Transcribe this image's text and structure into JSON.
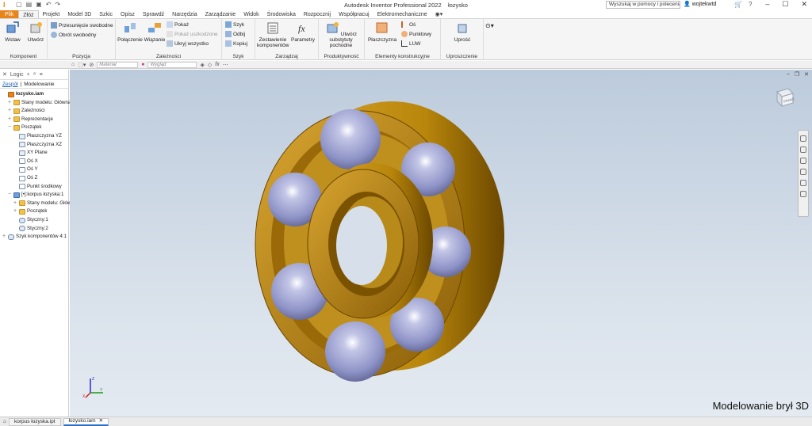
{
  "app": {
    "logo": "I",
    "title": "Autodesk Inventor Professional 2022",
    "document": "łozysko",
    "help_search_placeholder": "Wyszukaj w pomocy i poleceniach...",
    "user": "wojtekwtd",
    "win_buttons": [
      "–",
      "☐",
      "✕"
    ]
  },
  "ribbon_tabs": [
    "Plik",
    "Złóż",
    "Projekt",
    "Model 3D",
    "Szkic",
    "Opisz",
    "Sprawdź",
    "Narzędzia",
    "Zarządzanie",
    "Widok",
    "Środowiska",
    "Rozpocznij",
    "Współpracuj",
    "Elektromechaniczne"
  ],
  "ribbon": {
    "komponent": {
      "title": "Komponent",
      "wstaw": "Wstaw",
      "utworz": "Utwórz"
    },
    "pozycja": {
      "title": "Pozycja",
      "przesuniecie": "Przesunięcie swobodne",
      "obrot": "Obrót swobodny"
    },
    "zaleznosci": {
      "title": "Zależności",
      "polaczenie": "Połączenie",
      "wiazanie": "Wiązanie",
      "pokaz": "Pokaż",
      "pokaz_uszkodzone": "Pokaż uszkodzone",
      "ukryj": "Ukryj wszystko"
    },
    "szyk": {
      "title": "Szyk",
      "szyk": "Szyk",
      "odbij": "Odbij",
      "kopiuj": "Kopiuj"
    },
    "zarzadzaj": {
      "title": "Zarządzaj",
      "zestawienie": "Zestawienie komponentów",
      "parametry": "Parametry"
    },
    "produktywnosc": {
      "title": "Produktywność",
      "utworz_substytut": "Utwórz substytuty pochodne"
    },
    "elementy": {
      "title": "Elementy konstrukcyjne",
      "plaszczyzna": "Płaszczyzna",
      "os": "Oś",
      "punktowy": "Punktowy",
      "luw": "LUW"
    },
    "uproszczenie": {
      "title": "Uproszczenie",
      "uprosc": "Uprość"
    }
  },
  "toolbar2": {
    "material": "Materiał",
    "wyglad": "Wygląd"
  },
  "browser": {
    "filter": "Logic",
    "tabs": [
      "Zespół",
      "Modelowanie"
    ],
    "tree": [
      {
        "label": "łozysko.iam",
        "icon": "asm",
        "indent": 0,
        "pm": ""
      },
      {
        "label": "Stany modelu: Główna",
        "icon": "folder",
        "indent": 1,
        "pm": "+"
      },
      {
        "label": "Zależności",
        "icon": "folder",
        "indent": 1,
        "pm": "+"
      },
      {
        "label": "Reprezentacje",
        "icon": "folder",
        "indent": 1,
        "pm": "+"
      },
      {
        "label": "Początek",
        "icon": "folder",
        "indent": 1,
        "pm": "−"
      },
      {
        "label": "Płaszczyzna YZ",
        "icon": "plane",
        "indent": 2,
        "pm": ""
      },
      {
        "label": "Płaszczyzna XZ",
        "icon": "plane",
        "indent": 2,
        "pm": ""
      },
      {
        "label": "XY Plane",
        "icon": "plane",
        "indent": 2,
        "pm": ""
      },
      {
        "label": "Oś X",
        "icon": "axis",
        "indent": 2,
        "pm": ""
      },
      {
        "label": "Oś Y",
        "icon": "axis",
        "indent": 2,
        "pm": ""
      },
      {
        "label": "Oś Z",
        "icon": "axis",
        "indent": 2,
        "pm": ""
      },
      {
        "label": "Punkt środkowy",
        "icon": "axis",
        "indent": 2,
        "pm": ""
      },
      {
        "label": "[•]:korpus łozyska:1",
        "icon": "part",
        "indent": 1,
        "pm": "−"
      },
      {
        "label": "Stany modelu: Główna",
        "icon": "folder",
        "indent": 2,
        "pm": "+"
      },
      {
        "label": "Początek",
        "icon": "folder",
        "indent": 2,
        "pm": "+"
      },
      {
        "label": "Styczny:1",
        "icon": "constraint",
        "indent": 2,
        "pm": ""
      },
      {
        "label": "Styczny:2",
        "icon": "constraint",
        "indent": 2,
        "pm": ""
      },
      {
        "label": "Szyk komponentów 4:1",
        "icon": "constraint",
        "indent": 0,
        "pm": "+"
      }
    ]
  },
  "viewport": {
    "caption": "Modelowanie brył 3D",
    "viewcube_label": "PRAWO",
    "triad": {
      "x": "X",
      "y": "Y",
      "z": "Z"
    }
  },
  "doc_tabs": [
    "korpus łozyska.ipt",
    "łozysko.iam"
  ],
  "colors": {
    "accent": "#e8841a",
    "gold": "#b8860b",
    "ball": "#8e93c7"
  }
}
